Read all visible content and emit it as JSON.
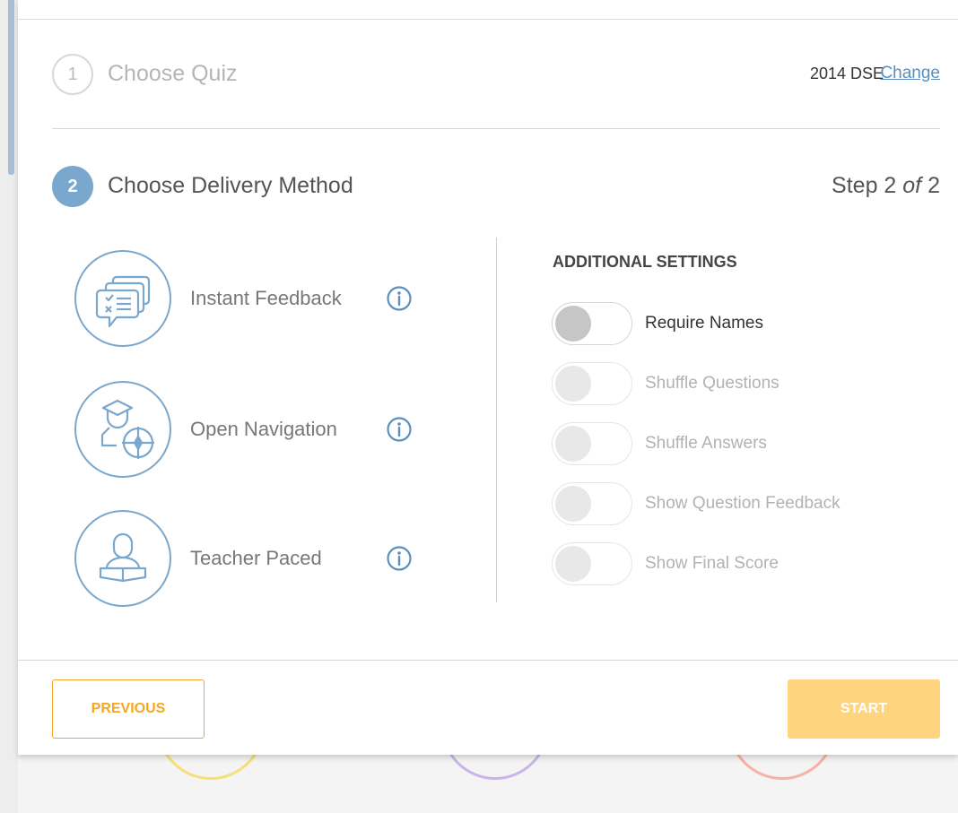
{
  "steps": {
    "step1": {
      "number": "1",
      "title": "Choose Quiz",
      "selected_quiz": "2014 DSE",
      "change_label": "Change"
    },
    "step2": {
      "number": "2",
      "title": "Choose Delivery Method",
      "indicator_prefix": "Step 2",
      "indicator_of": "of",
      "indicator_total": "2"
    }
  },
  "delivery_methods": [
    {
      "label": "Instant Feedback",
      "icon": "chat-feedback-icon"
    },
    {
      "label": "Open Navigation",
      "icon": "student-compass-icon"
    },
    {
      "label": "Teacher Paced",
      "icon": "teacher-book-icon"
    }
  ],
  "settings": {
    "title": "ADDITIONAL SETTINGS",
    "toggles": [
      {
        "label": "Require Names",
        "enabled": true,
        "on": false
      },
      {
        "label": "Shuffle Questions",
        "enabled": false,
        "on": false
      },
      {
        "label": "Shuffle Answers",
        "enabled": false,
        "on": false
      },
      {
        "label": "Show Question Feedback",
        "enabled": false,
        "on": false
      },
      {
        "label": "Show Final Score",
        "enabled": false,
        "on": false
      }
    ]
  },
  "footer": {
    "previous_label": "PREVIOUS",
    "start_label": "START"
  },
  "colors": {
    "accent_blue": "#7aa7cd",
    "orange": "#f6a623",
    "start_disabled": "#fed47f",
    "link": "#5b8fbf"
  }
}
